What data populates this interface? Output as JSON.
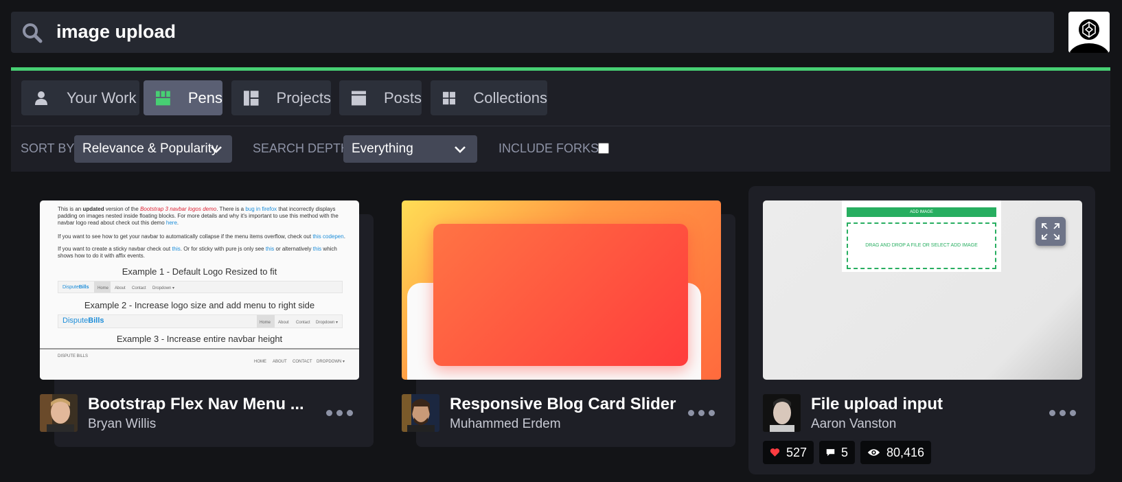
{
  "search": {
    "query": "image upload"
  },
  "tabs": [
    {
      "label": "Your Work",
      "icon": "user-icon"
    },
    {
      "label": "Pens",
      "icon": "pens-grid-icon",
      "active": true
    },
    {
      "label": "Projects",
      "icon": "projects-icon"
    },
    {
      "label": "Posts",
      "icon": "posts-icon"
    },
    {
      "label": "Collections",
      "icon": "collections-icon"
    }
  ],
  "filters": {
    "sort_label": "SORT BY",
    "sort_value": "Relevance & Popularity",
    "depth_label": "SEARCH DEPTH",
    "depth_value": "Everything",
    "forks_label": "INCLUDE FORKS?"
  },
  "cards": [
    {
      "title": "Bootstrap Flex Nav Menu ...",
      "author": "Bryan Willis",
      "preview": {
        "p1_pre": "This is an ",
        "p1_bold": "updated",
        "p1_mid": " version of the ",
        "p1_link1": "Bootstrap 3 navbar logos demo",
        "p1_mid2": ". There is a ",
        "p1_link2": "bug in firefox",
        "p1_rest": " that incorrectly displays padding on images nested inside floating blocks. For more details and why it's important to use this method with the navbar logo read about check out this demo ",
        "p1_link3": "here",
        "p2": "If you want to see how to get your navbar to automatically collapse if the menu items overflow, check out",
        "p2_link": "this codepen",
        "p3_a": "If you want to create a sticky navbar check out ",
        "p3_link1": "this",
        "p3_b": ". Or for sticky with pure js only see ",
        "p3_link2": "this",
        "p3_c": " or alternatively ",
        "p3_link3": "this",
        "p3_d": " which shows how to do it with affix events.",
        "ex1": "Example 1 - Default Logo Resized to fit",
        "ex2": "Example 2 - Increase logo size and add menu to right side",
        "ex3": "Example 3 - Increase entire navbar height",
        "brand_a": "Dispute",
        "brand_b": "Bills",
        "brand_alt": "DISPUTE BILLS",
        "nav1": [
          "Home",
          "About",
          "Contact",
          "Dropdown ▾"
        ],
        "nav3": [
          "HOME",
          "ABOUT",
          "CONTACT",
          "DROPDOWN ▾"
        ]
      }
    },
    {
      "title": "Responsive Blog Card Slider",
      "author": "Muhammed Erdem"
    },
    {
      "title": "File upload input",
      "author": "Aaron Vanston",
      "preview": {
        "add_button": "ADD IMAGE",
        "drop_text": "DRAG AND DROP A FILE OR SELECT ADD IMAGE"
      },
      "stats": {
        "likes": "527",
        "comments": "5",
        "views": "80,416"
      }
    }
  ],
  "colors": {
    "accent": "#47cf73",
    "link": "#1c8dd9",
    "heart": "#ff3c41"
  }
}
